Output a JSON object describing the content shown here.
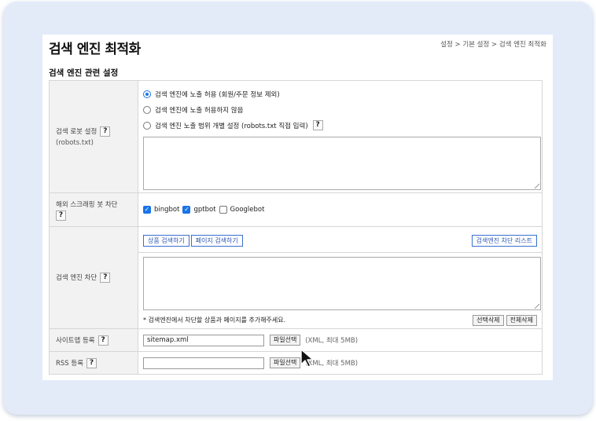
{
  "page": {
    "title": "검색 엔진 최적화",
    "breadcrumb": "설정 > 기본 설정 > 검색 엔진 최적화",
    "section_title": "검색 엔진 관련 설정"
  },
  "robots": {
    "label": "검색 로봇 설정",
    "sub_label": "(robots.txt)",
    "help": "?",
    "options": [
      {
        "label": "검색 엔진에 노출 허용 (회원/주문 정보 제외)",
        "selected": true
      },
      {
        "label": "검색 엔진에 노출 허용하지 않음",
        "selected": false
      },
      {
        "label": "검색 엔진 노출 범위 개별 설정 (robots.txt 직접 입력)",
        "selected": false
      }
    ],
    "option3_help": "?",
    "textarea_value": ""
  },
  "scraping": {
    "label": "해외 스크래핑 봇 차단",
    "help": "?",
    "bots": [
      {
        "label": "bingbot",
        "checked": true
      },
      {
        "label": "gptbot",
        "checked": true
      },
      {
        "label": "Googlebot",
        "checked": false
      }
    ]
  },
  "block": {
    "label": "검색 엔진 차단",
    "help": "?",
    "search_product_button": "상품 검색하기",
    "search_page_button": "페이지 검색하기",
    "block_list_button": "검색엔진 차단 리스트",
    "textarea_value": "",
    "notice": "* 검색엔진에서 차단할 상품과 페이지를 추가해주세요.",
    "delete_selected_button": "선택삭제",
    "delete_all_button": "전체삭제"
  },
  "sitemap": {
    "label": "사이트맵 등록",
    "help": "?",
    "file_value": "sitemap.xml",
    "file_button": "파일선택",
    "note": "(XML, 최대 5MB)"
  },
  "rss": {
    "label": "RSS 등록",
    "help": "?",
    "file_value": "",
    "file_button": "파일선택",
    "note": "(XML, 최대 5MB)"
  },
  "colors": {
    "frame_bg": "#e3ebf9",
    "accent": "#1a73e8",
    "label_bg": "#f2f2f2"
  },
  "icons": {
    "cursor": "mouse-pointer-icon"
  }
}
